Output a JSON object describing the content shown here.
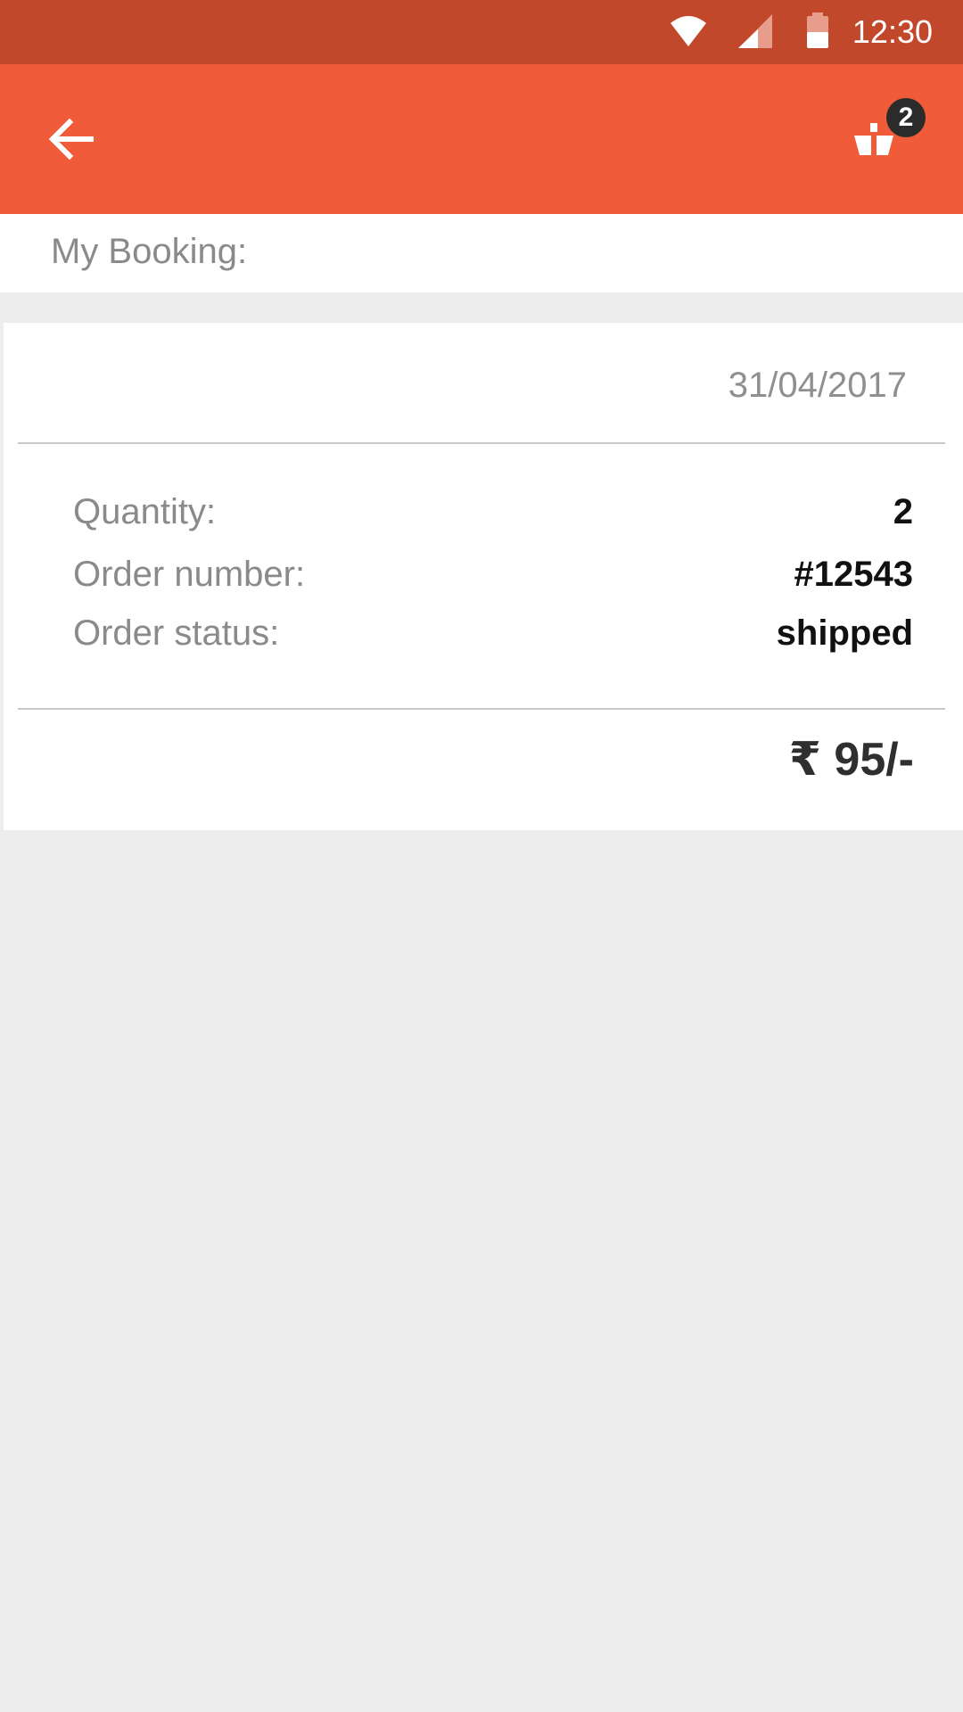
{
  "status_bar": {
    "time": "12:30",
    "icons": [
      "wifi-icon",
      "cellular-signal-icon",
      "battery-icon"
    ],
    "background": "#c2482c"
  },
  "app_bar": {
    "background": "#f05b3a",
    "back_icon": "arrow-left-icon",
    "cart_icon": "shopping-basket-icon",
    "cart_count": "2"
  },
  "page": {
    "title": "My Booking:"
  },
  "order": {
    "date": "31/04/2017",
    "details": [
      {
        "label": "Quantity:",
        "value": "2"
      },
      {
        "label": "Order number:",
        "value": "#12543"
      },
      {
        "label": "Order status:",
        "value": "shipped"
      }
    ],
    "price": "₹ 95/-"
  }
}
